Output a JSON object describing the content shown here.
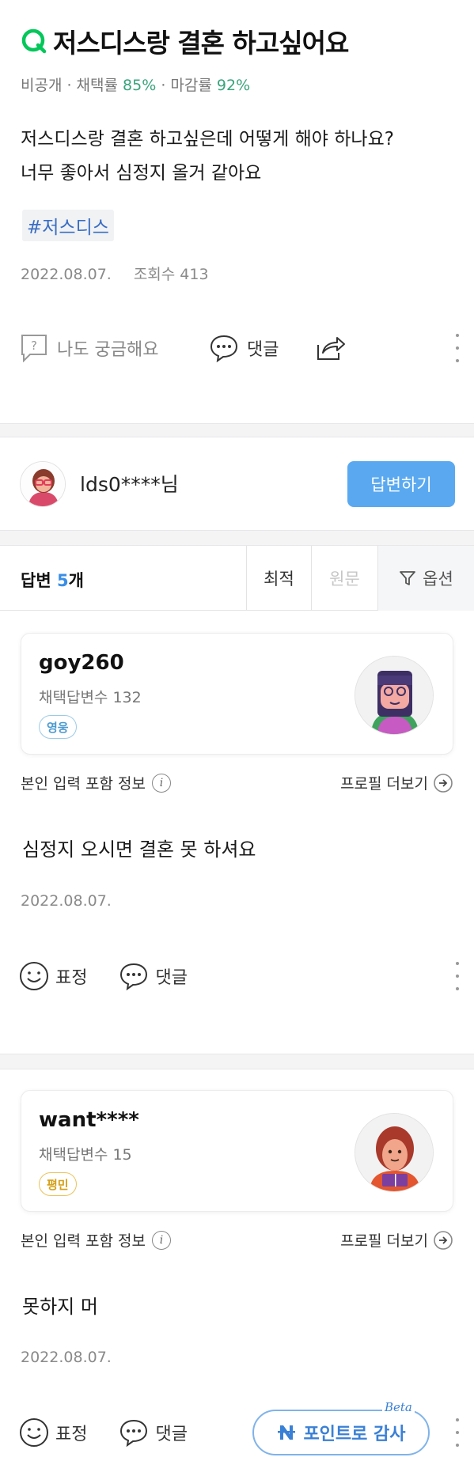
{
  "question": {
    "title": "저스디스랑 결혼 하고싶어요",
    "meta_prefix": "비공개 · 채택률 ",
    "adopt_rate": "85%",
    "meta_mid": " · 마감률 ",
    "close_rate": "92%",
    "body_line1": "저스디스랑 결혼 하고싶은데 어떻게 해야 하나요?",
    "body_line2": "너무 좋아서 심정지 올거 같아요",
    "hashtag": "#저스디스",
    "date": "2022.08.07.",
    "views": "조회수 413",
    "curious_label": "나도 궁금해요",
    "comment_label": "댓글"
  },
  "asker": {
    "name": "lds0****님",
    "answer_button": "답변하기"
  },
  "tabs": {
    "count_prefix": "답변 ",
    "count_num": "5",
    "count_suffix": "개",
    "best": "최적",
    "original": "원문",
    "option": "옵션"
  },
  "answers": [
    {
      "username": "goy260",
      "adopted_count": "채택답변수 132",
      "rank": "영웅",
      "info_label": "본인 입력 포함 정보",
      "profile_more": "프로필 더보기",
      "text": "심정지 오시면 결혼 못 하셔요",
      "date": "2022.08.07.",
      "emotion_label": "표정",
      "comment_label": "댓글"
    },
    {
      "username": "want****",
      "adopted_count": "채택답변수 15",
      "rank": "평민",
      "info_label": "본인 입력 포함 정보",
      "profile_more": "프로필 더보기",
      "text": "못하지 머",
      "date": "2022.08.07.",
      "emotion_label": "표정",
      "comment_label": "댓글",
      "thanks_label": "포인트로 감사",
      "beta_label": "Beta"
    }
  ],
  "colors": {
    "accent_green": "#03c75a",
    "rate_green": "#39a37c",
    "button_blue": "#5aa9f0",
    "hashtag_blue": "#3a6dc4"
  }
}
